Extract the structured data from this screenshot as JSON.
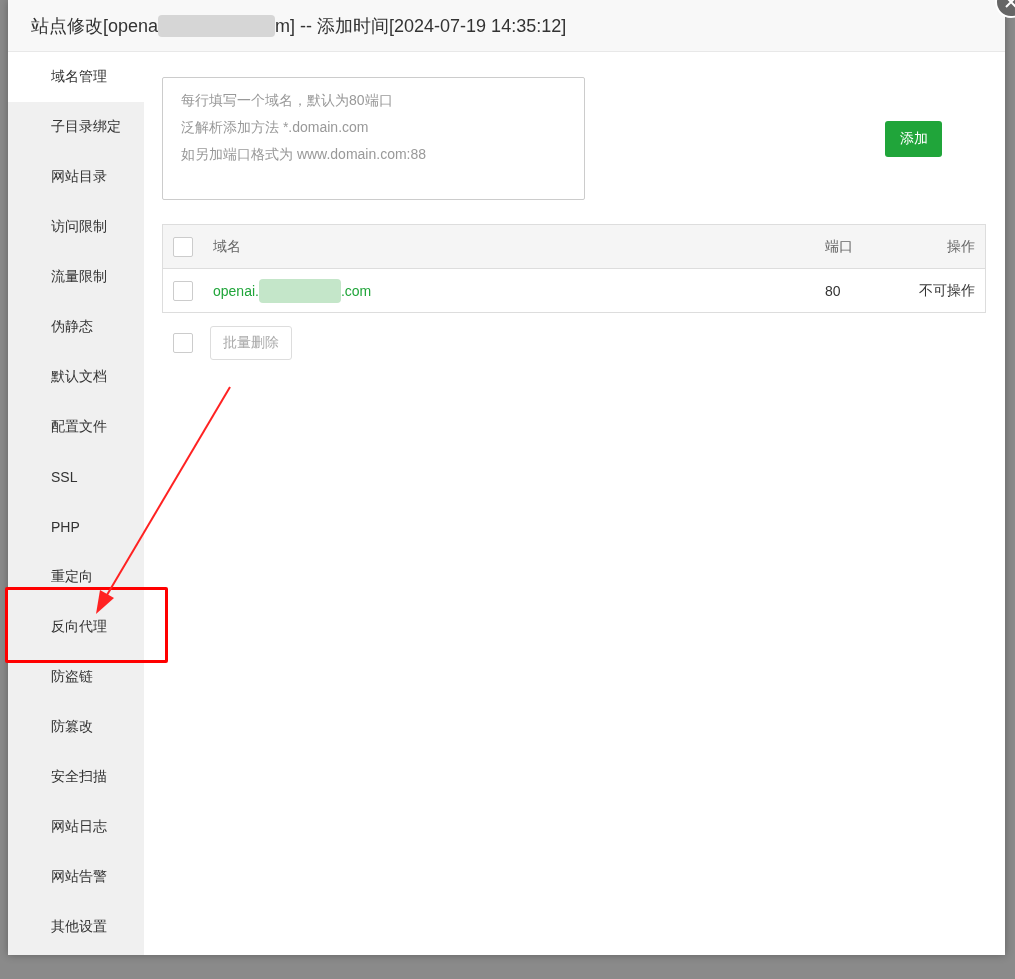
{
  "dialog": {
    "title_start": "站点修改[opena",
    "title_end": "m] -- 添加时间[2024-07-19 14:35:12]",
    "title_redacted": true
  },
  "sidebar": {
    "items": [
      {
        "label": "域名管理",
        "selected": true,
        "highlighted": false
      },
      {
        "label": "子目录绑定",
        "selected": false,
        "highlighted": false
      },
      {
        "label": "网站目录",
        "selected": false,
        "highlighted": false
      },
      {
        "label": "访问限制",
        "selected": false,
        "highlighted": false
      },
      {
        "label": "流量限制",
        "selected": false,
        "highlighted": false
      },
      {
        "label": "伪静态",
        "selected": false,
        "highlighted": false
      },
      {
        "label": "默认文档",
        "selected": false,
        "highlighted": false
      },
      {
        "label": "配置文件",
        "selected": false,
        "highlighted": false
      },
      {
        "label": "SSL",
        "selected": false,
        "highlighted": false
      },
      {
        "label": "PHP",
        "selected": false,
        "highlighted": false
      },
      {
        "label": "重定向",
        "selected": false,
        "highlighted": false
      },
      {
        "label": "反向代理",
        "selected": false,
        "highlighted": true
      },
      {
        "label": "防盗链",
        "selected": false,
        "highlighted": false
      },
      {
        "label": "防篡改",
        "selected": false,
        "highlighted": false
      },
      {
        "label": "安全扫描",
        "selected": false,
        "highlighted": false
      },
      {
        "label": "网站日志",
        "selected": false,
        "highlighted": false
      },
      {
        "label": "网站告警",
        "selected": false,
        "highlighted": false
      },
      {
        "label": "其他设置",
        "selected": false,
        "highlighted": false
      }
    ]
  },
  "domain_input": {
    "placeholder": [
      "每行填写一个域名，默认为80端口",
      "泛解析添加方法 *.domain.com",
      "如另加端口格式为 www.domain.com:88"
    ]
  },
  "add_button": "添加",
  "table": {
    "columns": [
      "域名",
      "端口",
      "操作"
    ],
    "header_checked": false,
    "rows": [
      {
        "checked": false,
        "domain_start": "openai.",
        "domain_end": ".com",
        "domain_redacted": true,
        "port": "80",
        "action": "不可操作"
      }
    ]
  },
  "footer": {
    "checked": false,
    "batch_delete": "批量删除",
    "batch_delete_disabled": true
  }
}
